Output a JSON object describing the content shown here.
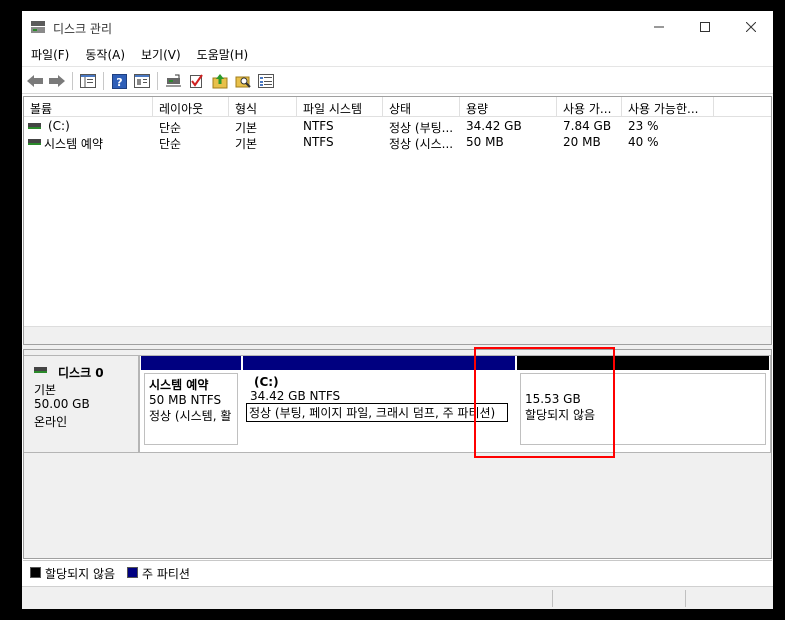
{
  "window": {
    "title": "디스크 관리"
  },
  "menu": [
    "파일(F)",
    "동작(A)",
    "보기(V)",
    "도움말(H)"
  ],
  "toolbar_icons": [
    "back-arrow-icon",
    "forward-arrow-icon",
    "console-tree-icon",
    "help-icon",
    "properties-icon",
    "connect-disk-icon",
    "check-icon",
    "up-folder-icon",
    "search-folder-icon",
    "list-view-icon"
  ],
  "volumes": {
    "columns": [
      "볼륨",
      "레이아웃",
      "형식",
      "파일 시스템",
      "상태",
      "용량",
      "사용 가...",
      "사용 가능한..."
    ],
    "rows": [
      {
        "name": "(C:)",
        "layout": "단순",
        "type": "기본",
        "fs": "NTFS",
        "status": "정상 (부팅...",
        "capacity": "34.42 GB",
        "free": "7.84 GB",
        "free_pct": "23 %"
      },
      {
        "name": "시스템 예약",
        "layout": "단순",
        "type": "기본",
        "fs": "NTFS",
        "status": "정상 (시스...",
        "capacity": "50 MB",
        "free": "20 MB",
        "free_pct": "40 %"
      }
    ]
  },
  "disk": {
    "name": "디스크 0",
    "type": "기본",
    "size": "50.00 GB",
    "status": "온라인",
    "partitions": [
      {
        "title": "시스템 예약",
        "line1": "50 MB NTFS",
        "line2": "정상 (시스템, 활",
        "bar_color": "#000080"
      },
      {
        "title": "(C:)",
        "line1": "34.42 GB NTFS",
        "line2": "정상 (부팅, 페이지 파일, 크래시 덤프, 주 파티션)",
        "bar_color": "#000080"
      },
      {
        "title": "",
        "line1": "15.53 GB",
        "line2": "할당되지 않음",
        "bar_color": "#000000"
      }
    ]
  },
  "legend": {
    "unallocated": {
      "label": "할당되지 않음",
      "color": "#000000"
    },
    "primary": {
      "label": "주 파티션",
      "color": "#000080"
    }
  },
  "colors": {
    "highlight": "#ff0000"
  }
}
